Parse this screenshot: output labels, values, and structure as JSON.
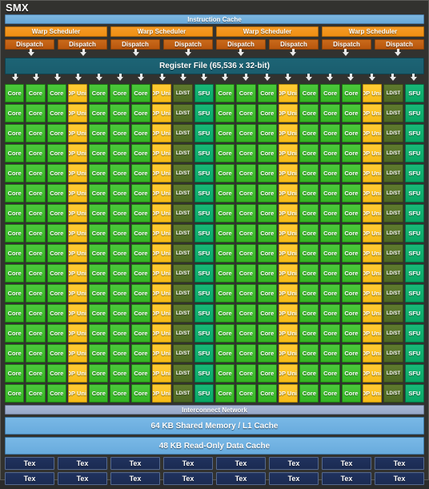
{
  "title": "SMX",
  "instruction_cache": {
    "label": "Instruction Cache"
  },
  "warp_schedulers": [
    {
      "label": "Warp Scheduler",
      "dispatch": [
        {
          "label": "Dispatch"
        },
        {
          "label": "Dispatch"
        }
      ]
    },
    {
      "label": "Warp Scheduler",
      "dispatch": [
        {
          "label": "Dispatch"
        },
        {
          "label": "Dispatch"
        }
      ]
    },
    {
      "label": "Warp Scheduler",
      "dispatch": [
        {
          "label": "Dispatch"
        },
        {
          "label": "Dispatch"
        }
      ]
    },
    {
      "label": "Warp Scheduler",
      "dispatch": [
        {
          "label": "Dispatch"
        },
        {
          "label": "Dispatch"
        }
      ]
    }
  ],
  "register_file": {
    "label": "Register File (65,536 x 32-bit)"
  },
  "execution_grid": {
    "columns": 20,
    "rows": 16,
    "column_pattern": [
      "Core",
      "Core",
      "Core",
      "DP Unit",
      "Core",
      "Core",
      "Core",
      "DP Unit",
      "LD/ST",
      "SFU",
      "Core",
      "Core",
      "Core",
      "DP Unit",
      "Core",
      "Core",
      "Core",
      "DP Unit",
      "LD/ST",
      "SFU"
    ],
    "unit_labels": {
      "core": "Core",
      "dp": "DP Unit",
      "ldst": "LD/ST",
      "sfu": "SFU"
    },
    "counts": {
      "core": 192,
      "dp_unit": 64,
      "ldst": 32,
      "sfu": 32
    },
    "colors": {
      "core": "#34b522",
      "dp": "#f7bc17",
      "ldst": "#4e6824",
      "sfu": "#08a765"
    }
  },
  "interconnect": {
    "label": "Interconnect Network"
  },
  "shared_memory": {
    "label": "64 KB Shared Memory / L1 Cache"
  },
  "readonly_cache": {
    "label": "48 KB Read-Only Data Cache"
  },
  "texture_units": {
    "label": "Tex",
    "rows": 2,
    "per_row": 8,
    "items": [
      "Tex",
      "Tex",
      "Tex",
      "Tex",
      "Tex",
      "Tex",
      "Tex",
      "Tex",
      "Tex",
      "Tex",
      "Tex",
      "Tex",
      "Tex",
      "Tex",
      "Tex",
      "Tex"
    ]
  },
  "colors": {
    "background": "#32322f",
    "instruction_cache": "#6aa9d8",
    "warp_scheduler": "#ef8e12",
    "dispatch": "#b9560d",
    "register_file": "#1a5d6e",
    "interconnect": "#97a8ca",
    "cache": "#68abdd",
    "tex": "#1b2b52"
  }
}
